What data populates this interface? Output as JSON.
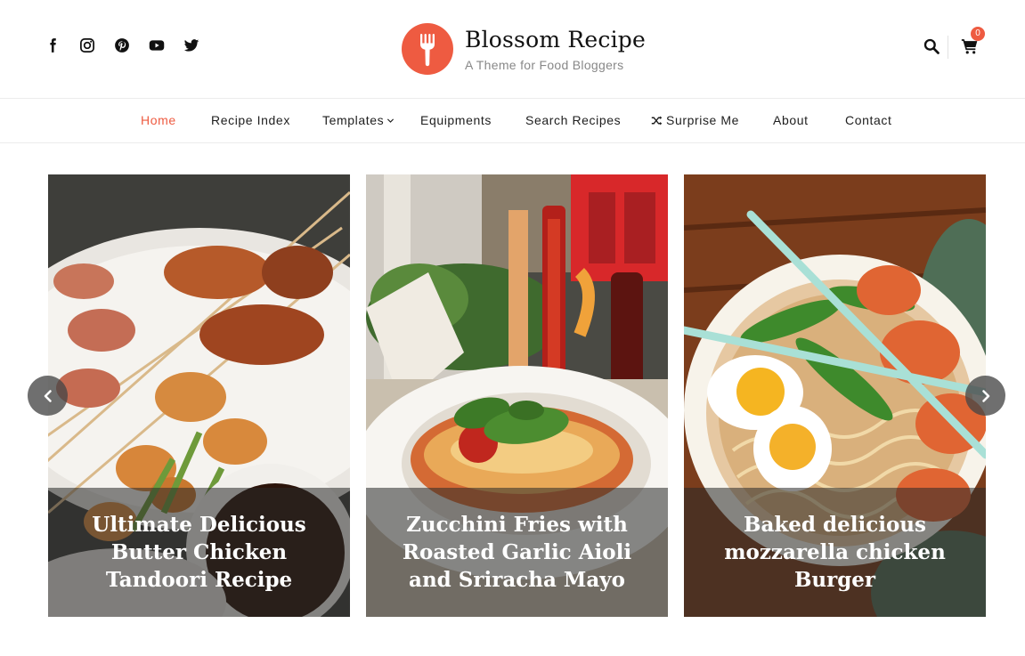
{
  "brand": {
    "title": "Blossom Recipe",
    "tagline": "A Theme for Food Bloggers",
    "accent_color": "#ee5b41"
  },
  "social_icons": [
    "facebook-icon",
    "instagram-icon",
    "pinterest-icon",
    "youtube-icon",
    "twitter-icon"
  ],
  "header_tools": {
    "search_icon": "search-icon",
    "cart_icon": "cart-icon",
    "cart_count": "0"
  },
  "nav": {
    "items": [
      {
        "label": "Home",
        "active": true
      },
      {
        "label": "Recipe Index"
      },
      {
        "label": "Templates",
        "has_dropdown": true
      },
      {
        "label": "Equipments"
      },
      {
        "label": "Search Recipes"
      },
      {
        "label": "Surprise Me",
        "icon": "shuffle-icon"
      },
      {
        "label": "About"
      },
      {
        "label": "Contact"
      }
    ]
  },
  "slider": {
    "slides": [
      {
        "title": "Ultimate Delicious Butter Chicken Tandoori Recipe"
      },
      {
        "title": "Zucchini Fries with Roasted Garlic Aioli and Sriracha Mayo"
      },
      {
        "title": "Baked delicious mozzarella chicken Burger"
      }
    ],
    "prev_icon": "chevron-left-icon",
    "next_icon": "chevron-right-icon"
  }
}
